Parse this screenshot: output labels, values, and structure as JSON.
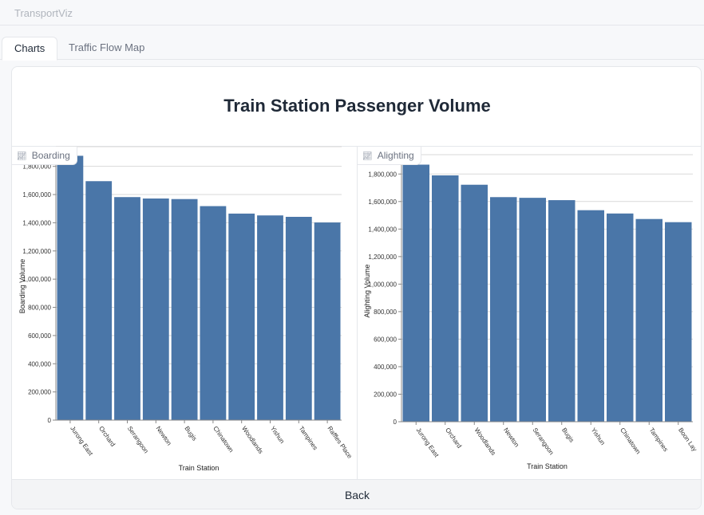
{
  "app": {
    "title": "TransportViz"
  },
  "tabs": [
    {
      "label": "Charts",
      "active": true
    },
    {
      "label": "Traffic Flow Map",
      "active": false
    }
  ],
  "page": {
    "title": "Train Station Passenger Volume",
    "back_label": "Back"
  },
  "colors": {
    "bar": "#4a76a8",
    "grid": "#d9d9d9",
    "axis": "#888888"
  },
  "chart_data": [
    {
      "type": "bar",
      "label": "Boarding",
      "icon": "chart-icon",
      "categories": [
        "Jurong East",
        "Orchard",
        "Serangoon",
        "Newton",
        "Bugis",
        "Chinatown",
        "Woodlands",
        "Yishun",
        "Tampines",
        "Raffles Place"
      ],
      "values": [
        1875000,
        1695000,
        1582000,
        1572000,
        1568000,
        1518000,
        1465000,
        1452000,
        1442000,
        1402000
      ],
      "xlabel": "Train Station",
      "ylabel": "Boarding Volume",
      "ylim": [
        0,
        1900000
      ],
      "yticks": [
        0,
        200000,
        400000,
        600000,
        800000,
        1000000,
        1200000,
        1400000,
        1600000,
        1800000
      ],
      "ytick_labels": [
        "0",
        "200,000",
        "400,000",
        "600,000",
        "800,000",
        "1,000,000",
        "1,200,000",
        "1,400,000",
        "1,600,000",
        "1,800,000"
      ],
      "grid": true
    },
    {
      "type": "bar",
      "label": "Alighting",
      "icon": "chart-icon",
      "categories": [
        "Jurong East",
        "Orchard",
        "Woodlands",
        "Newton",
        "Serangoon",
        "Bugis",
        "Yishun",
        "Chinatown",
        "Tampines",
        "Boon Lay"
      ],
      "values": [
        1868000,
        1790000,
        1722000,
        1632000,
        1627000,
        1610000,
        1537000,
        1513000,
        1473000,
        1450000
      ],
      "xlabel": "Train Station",
      "ylabel": "Alighting Volume",
      "ylim": [
        0,
        1900000
      ],
      "yticks": [
        0,
        200000,
        400000,
        600000,
        800000,
        1000000,
        1200000,
        1400000,
        1600000,
        1800000
      ],
      "ytick_labels": [
        "0",
        "200,000",
        "400,000",
        "600,000",
        "800,000",
        "1,000,000",
        "1,200,000",
        "1,400,000",
        "1,600,000",
        "1,800,000"
      ],
      "grid": true
    }
  ]
}
